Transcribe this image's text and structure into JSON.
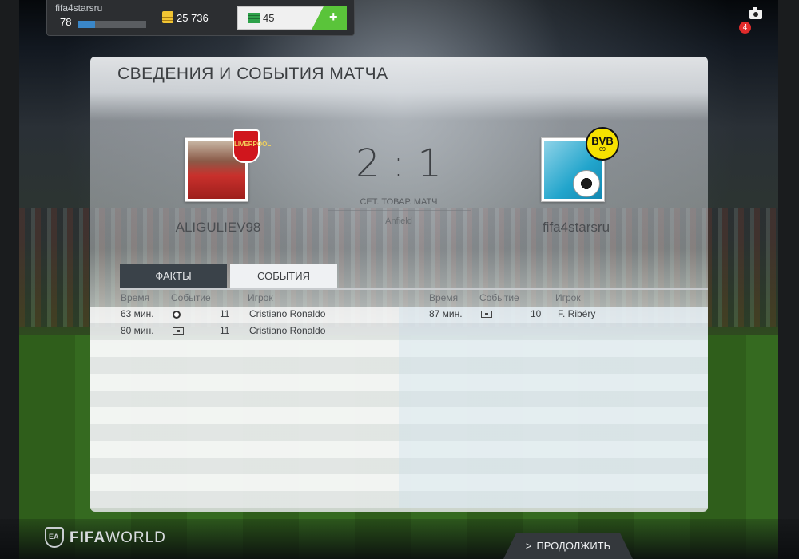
{
  "hud": {
    "username": "fifa4starsru",
    "level": "78",
    "xp_progress": 0.25,
    "coins": "25 736",
    "points": "45",
    "add_points_label": "+",
    "notifications_count": "4"
  },
  "panel": {
    "title": "СВЕДЕНИЯ И СОБЫТИЯ МАТЧА",
    "home_team": "ALIGULIEV98",
    "away_team": "fifa4starsru",
    "score": "2 : 1",
    "match_type": "СЕТ. ТОВАР. МАТЧ",
    "venue": "Anfield",
    "home_crest_text": "LIVERPOOL",
    "away_crest_text": "BVB",
    "away_crest_sub": "09"
  },
  "tabs": {
    "facts": "ФАКТЫ",
    "events": "СОБЫТИЯ"
  },
  "table": {
    "headers": {
      "time": "Время",
      "event": "Событие",
      "player": "Игрок"
    },
    "home_events": [
      {
        "time": "63 мин.",
        "event_icon": "goal-icon",
        "number": "11",
        "player": "Cristiano Ronaldo"
      },
      {
        "time": "80 мин.",
        "event_icon": "substitution-icon",
        "number": "11",
        "player": "Cristiano Ronaldo"
      }
    ],
    "away_events": [
      {
        "time": "87 мин.",
        "event_icon": "substitution-icon",
        "number": "10",
        "player": "F. Ribéry"
      }
    ]
  },
  "footer": {
    "logo_bold": "FIFA",
    "logo_light": "WORLD",
    "logo_badge": "EA",
    "continue_label": "ПРОДОЛЖИТЬ",
    "continue_chevron": ">"
  }
}
